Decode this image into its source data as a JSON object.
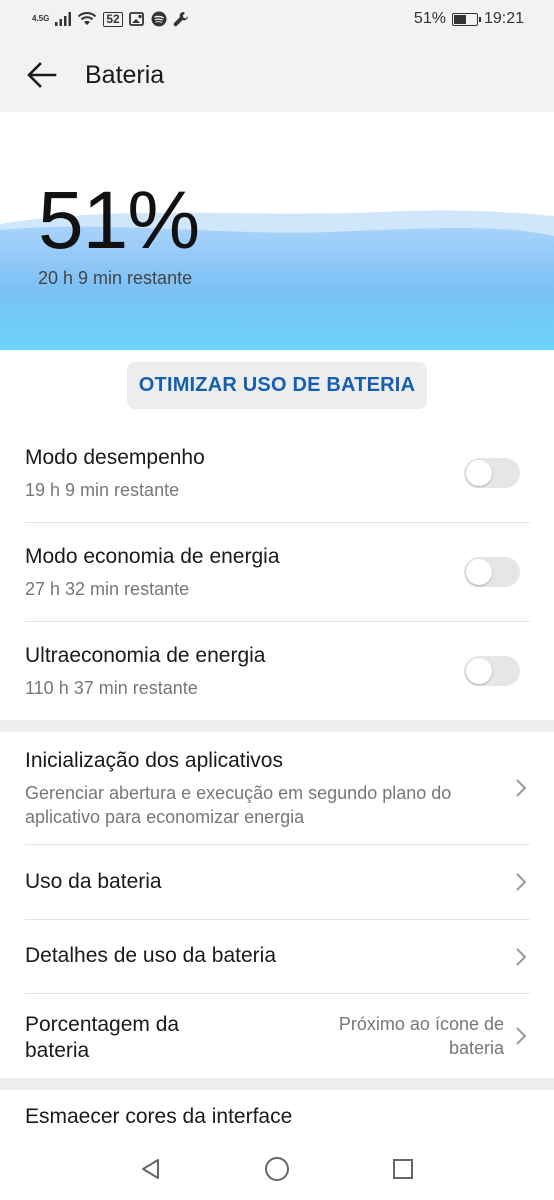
{
  "status_bar": {
    "network_type": "4.5G",
    "badge": "52",
    "battery_percent": "51%",
    "time": "19:21",
    "battery_level": 0.51,
    "icons": [
      "signal-icon",
      "wifi-icon",
      "notification-icon",
      "image-icon",
      "spotify-icon",
      "wrench-icon"
    ]
  },
  "app_bar": {
    "title": "Bateria",
    "back_icon": "arrow-left-icon"
  },
  "hero": {
    "percent": "51%",
    "remaining": "20 h 9 min restante",
    "wave_color_top": "#bfe0fb",
    "wave_color_bottom": "#6ad3fb"
  },
  "optimize_button": {
    "label": "OTIMIZAR USO DE BATERIA",
    "color": "#1560b0"
  },
  "modes": [
    {
      "title": "Modo desempenho",
      "subtitle": "19 h 9 min restante",
      "enabled": false
    },
    {
      "title": "Modo economia de energia",
      "subtitle": "27 h 32 min restante",
      "enabled": false
    },
    {
      "title": "Ultraeconomia de energia",
      "subtitle": "110 h 37 min restante",
      "enabled": false
    }
  ],
  "settings": [
    {
      "title": "Inicialização dos aplicativos",
      "subtitle": "Gerenciar abertura e execução em segundo plano do aplicativo para economizar energia"
    },
    {
      "title": "Uso da bateria"
    },
    {
      "title": "Detalhes de uso da bateria"
    },
    {
      "title": "Porcentagem da bateria",
      "value": "Próximo ao ícone de bateria"
    }
  ],
  "bottom_item": {
    "title": "Esmaecer cores da interface"
  },
  "nav_bar": {
    "icons": [
      "back-triangle-icon",
      "home-circle-icon",
      "recents-square-icon"
    ]
  }
}
